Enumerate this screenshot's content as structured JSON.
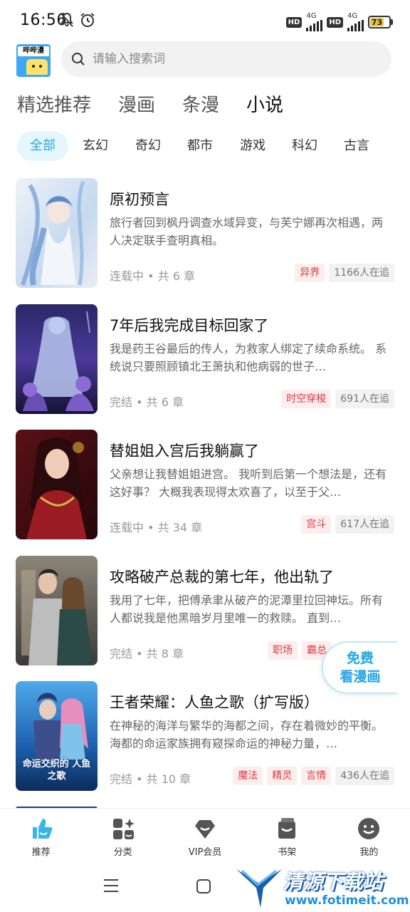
{
  "status_bar": {
    "time": "16:56",
    "hd1": "HD",
    "net1": "4G",
    "hd2": "HD",
    "net2": "4G",
    "battery": "73"
  },
  "header": {
    "logo_text": "哔哔漫",
    "search_placeholder": "请输入搜索词"
  },
  "tabs": [
    {
      "label": "精选推荐",
      "active": false
    },
    {
      "label": "漫画",
      "active": false
    },
    {
      "label": "条漫",
      "active": false
    },
    {
      "label": "小说",
      "active": true
    }
  ],
  "categories": [
    "全部",
    "玄幻",
    "奇幻",
    "都市",
    "游戏",
    "科幻",
    "古言"
  ],
  "books": [
    {
      "title": "原初预言",
      "desc": "旅行者回到枫丹调查水域异变，与芙宁娜再次相遇，两人决定联手查明真相。",
      "meta": "连载中 • 共 6 章",
      "tags": [
        {
          "text": "异界",
          "kind": "red"
        },
        {
          "text": "1166人在追",
          "kind": "gray"
        }
      ],
      "cover_colors": [
        "#e9eef4",
        "#7fa6d6",
        "#c9d8ec"
      ]
    },
    {
      "title": "7年后我完成目标回家了",
      "desc": "我是药王谷最后的传人，为救家人绑定了续命系统。 系统说只要照顾镇北王萧执和他病弱的世子…",
      "meta": "完结 • 共 6 章",
      "tags": [
        {
          "text": "时空穿梭",
          "kind": "red"
        },
        {
          "text": "691人在追",
          "kind": "gray"
        }
      ],
      "cover_colors": [
        "#1d1c4a",
        "#6a4fb3",
        "#b8c6ee"
      ]
    },
    {
      "title": "替姐姐入宫后我躺赢了",
      "desc": "父亲想让我替姐姐进宫。 我听到后第一个想法是，还有这好事？ 大概我表现得太欢喜了，以至于父…",
      "meta": "连载中 • 共 34 章",
      "tags": [
        {
          "text": "宫斗",
          "kind": "red"
        },
        {
          "text": "617人在追",
          "kind": "gray"
        }
      ],
      "cover_colors": [
        "#3a0a0e",
        "#9b1c22",
        "#e7b8a0"
      ]
    },
    {
      "title": "攻略破产总裁的第七年，他出轨了",
      "desc": "我用了七年，把傅承聿从破产的泥潭里拉回神坛。所有人都说我是他黑暗岁月里唯一的救赎。 直到…",
      "meta": "完结 • 共 8 章",
      "tags": [
        {
          "text": "职场",
          "kind": "red"
        },
        {
          "text": "霸总",
          "kind": "red"
        }
      ],
      "cover_colors": [
        "#5a5a5a",
        "#a89a86",
        "#2b4a48"
      ]
    },
    {
      "title": "王者荣耀：人鱼之歌（扩写版）",
      "desc": "在神秘的海洋与繁华的海都之间，存在着微妙的平衡。海都的命运家族拥有窥探命运的神秘力量，…",
      "meta": "完结 • 共 10 章",
      "tags": [
        {
          "text": "魔法",
          "kind": "red"
        },
        {
          "text": "精灵",
          "kind": "red"
        },
        {
          "text": "言情",
          "kind": "red"
        },
        {
          "text": "436人在追",
          "kind": "gray"
        }
      ],
      "cover_colors": [
        "#0f3b78",
        "#2f86d6",
        "#e58fbf"
      ],
      "cover_text": "命运交织的 人鱼之歌"
    }
  ],
  "float_button": {
    "line1": "免费",
    "line2": "看漫画"
  },
  "bottom_nav": [
    {
      "label": "推荐",
      "icon": "recommend-icon",
      "active": true
    },
    {
      "label": "分类",
      "icon": "category-icon",
      "active": false
    },
    {
      "label": "VIP会员",
      "icon": "vip-icon",
      "active": false
    },
    {
      "label": "书架",
      "icon": "bookshelf-icon",
      "active": false
    },
    {
      "label": "我的",
      "icon": "profile-icon",
      "active": false
    }
  ],
  "watermark": {
    "line1": "清源下载站",
    "line2": "www.fotimeit.com"
  },
  "colors": {
    "accent": "#29a7e0",
    "tag_red": "#e0383e",
    "tab_underline": "#a6e3f7"
  }
}
